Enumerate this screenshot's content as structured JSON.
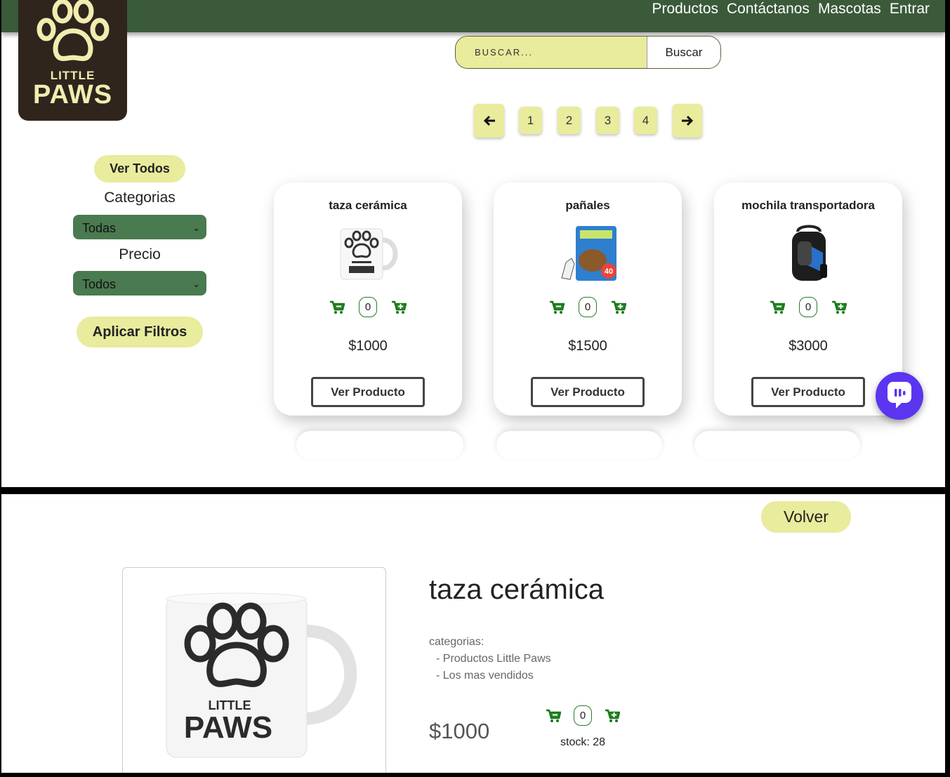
{
  "nav": {
    "links": [
      "Productos",
      "Contáctanos",
      "Mascotas",
      "Entrar"
    ]
  },
  "logo": {
    "line1": "LITTLE",
    "line2": "PAWS"
  },
  "search": {
    "placeholder": "BUSCAR...",
    "button": "Buscar"
  },
  "pagination": {
    "pages": [
      "1",
      "2",
      "3",
      "4"
    ],
    "prev_icon": "arrow-left-icon",
    "next_icon": "arrow-right-icon"
  },
  "sidebar": {
    "ver_todos": "Ver Todos",
    "categorias_label": "Categorias",
    "categorias_value": "Todas",
    "precio_label": "Precio",
    "precio_value": "Todos",
    "apply": "Aplicar Filtros"
  },
  "products": [
    {
      "name": "taza cerámica",
      "qty": "0",
      "price": "$1000",
      "button": "Ver Producto"
    },
    {
      "name": "pañales",
      "qty": "0",
      "price": "$1500",
      "button": "Ver Producto"
    },
    {
      "name": "mochila transportadora",
      "qty": "0",
      "price": "$3000",
      "button": "Ver Producto"
    }
  ],
  "detail": {
    "back": "Volver",
    "title": "taza cerámica",
    "categories_label": "categorias:",
    "categories": [
      "- Productos Little Paws",
      "- Los mas vendidos"
    ],
    "price": "$1000",
    "qty": "0",
    "stock": "stock: 28",
    "mug_text_1": "LITTLE",
    "mug_text_2": "PAWS",
    "badge_40": "40"
  },
  "colors": {
    "navbar": "#3a5a3a",
    "accent": "#e9eb9d",
    "select": "#4a7a50",
    "cart_green": "#1a7a1a",
    "chat": "#5b35f0"
  }
}
